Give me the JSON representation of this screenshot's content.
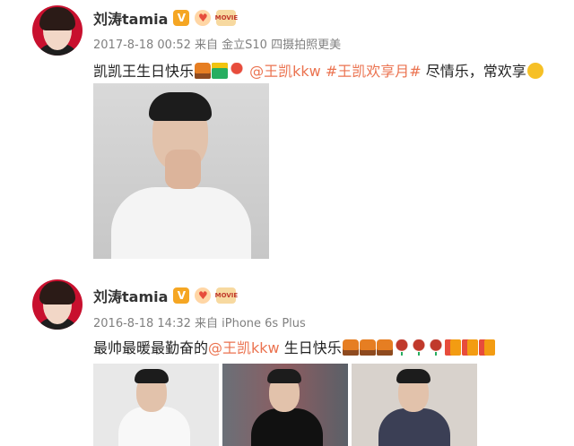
{
  "posts": [
    {
      "author": "刘涛tamia",
      "meta": "2017-8-18 00:52 来自 金立S10 四摄拍照更美",
      "text_before": "凯凯王生日快乐",
      "mention": "@王凯kkw",
      "hashtag": "#王凯欢享月#",
      "text_after": "尽情乐，常欢享",
      "emojis_a": [
        "cake-icon",
        "gift-icon",
        "lollipop-icon"
      ],
      "emojis_b": [
        "wink-icon"
      ]
    },
    {
      "author": "刘涛tamia",
      "meta": "2016-8-18 14:32 来自 iPhone 6s Plus",
      "text_before": "最帅最暖最勤奋的",
      "mention": "@王凯kkw",
      "text_after": " 生日快乐",
      "emojis_a": [
        "cake-icon",
        "cake-icon",
        "cake-icon",
        "rose-icon",
        "rose-icon",
        "rose-icon",
        "gift-icon",
        "gift-icon",
        "gift-icon"
      ]
    }
  ],
  "badges": {
    "verified": "V",
    "heart": "♥",
    "movie": "MOVIE"
  },
  "colors": {
    "link": "#eb7350",
    "meta": "#808080",
    "verified_badge": "#f5a623"
  }
}
